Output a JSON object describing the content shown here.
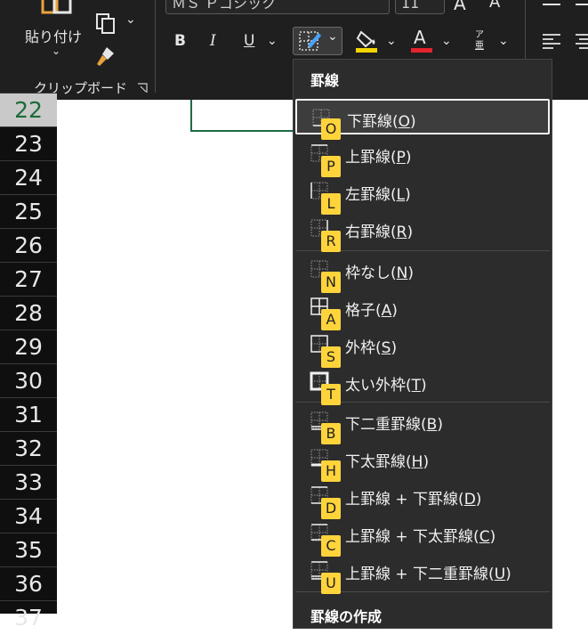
{
  "ribbon": {
    "font_name": "ＭＳ Ｐゴシック",
    "font_size": "11",
    "paste_label": "貼り付け",
    "clipboard_group": "クリップボード",
    "bold": "B",
    "italic": "I",
    "underline": "U",
    "grow_font": "A",
    "shrink_font": "A",
    "phonetic_top": "ア",
    "phonetic_bottom": "亜",
    "font_color_letter": "A",
    "fill_color": "#f2d600",
    "font_color": "#e3242b"
  },
  "rows": [
    "22",
    "23",
    "24",
    "25",
    "26",
    "27",
    "28",
    "29",
    "30",
    "31",
    "32",
    "33",
    "34",
    "35",
    "36",
    "37"
  ],
  "menu": {
    "header": "罫線",
    "footer_header": "罫線の作成",
    "items": [
      {
        "label": "下罫線(",
        "key": "O",
        "tail": ")",
        "badge": "O"
      },
      {
        "label": "上罫線(",
        "key": "P",
        "tail": ")",
        "badge": "P"
      },
      {
        "label": "左罫線(",
        "key": "L",
        "tail": ")",
        "badge": "L"
      },
      {
        "label": "右罫線(",
        "key": "R",
        "tail": ")",
        "badge": "R"
      },
      {
        "label": "枠なし(",
        "key": "N",
        "tail": ")",
        "badge": "N"
      },
      {
        "label": "格子(",
        "key": "A",
        "tail": ")",
        "badge": "A"
      },
      {
        "label": "外枠(",
        "key": "S",
        "tail": ")",
        "badge": "S"
      },
      {
        "label": "太い外枠(",
        "key": "T",
        "tail": ")",
        "badge": "T"
      },
      {
        "label": "下二重罫線(",
        "key": "B",
        "tail": ")",
        "badge": "B"
      },
      {
        "label": "下太罫線(",
        "key": "H",
        "tail": ")",
        "badge": "H"
      },
      {
        "label": "上罫線 + 下罫線(",
        "key": "D",
        "tail": ")",
        "badge": "D"
      },
      {
        "label": "上罫線 + 下太罫線(",
        "key": "C",
        "tail": ")",
        "badge": "C"
      },
      {
        "label": "上罫線 + 下二重罫線(",
        "key": "U",
        "tail": ")",
        "badge": "U"
      }
    ]
  }
}
